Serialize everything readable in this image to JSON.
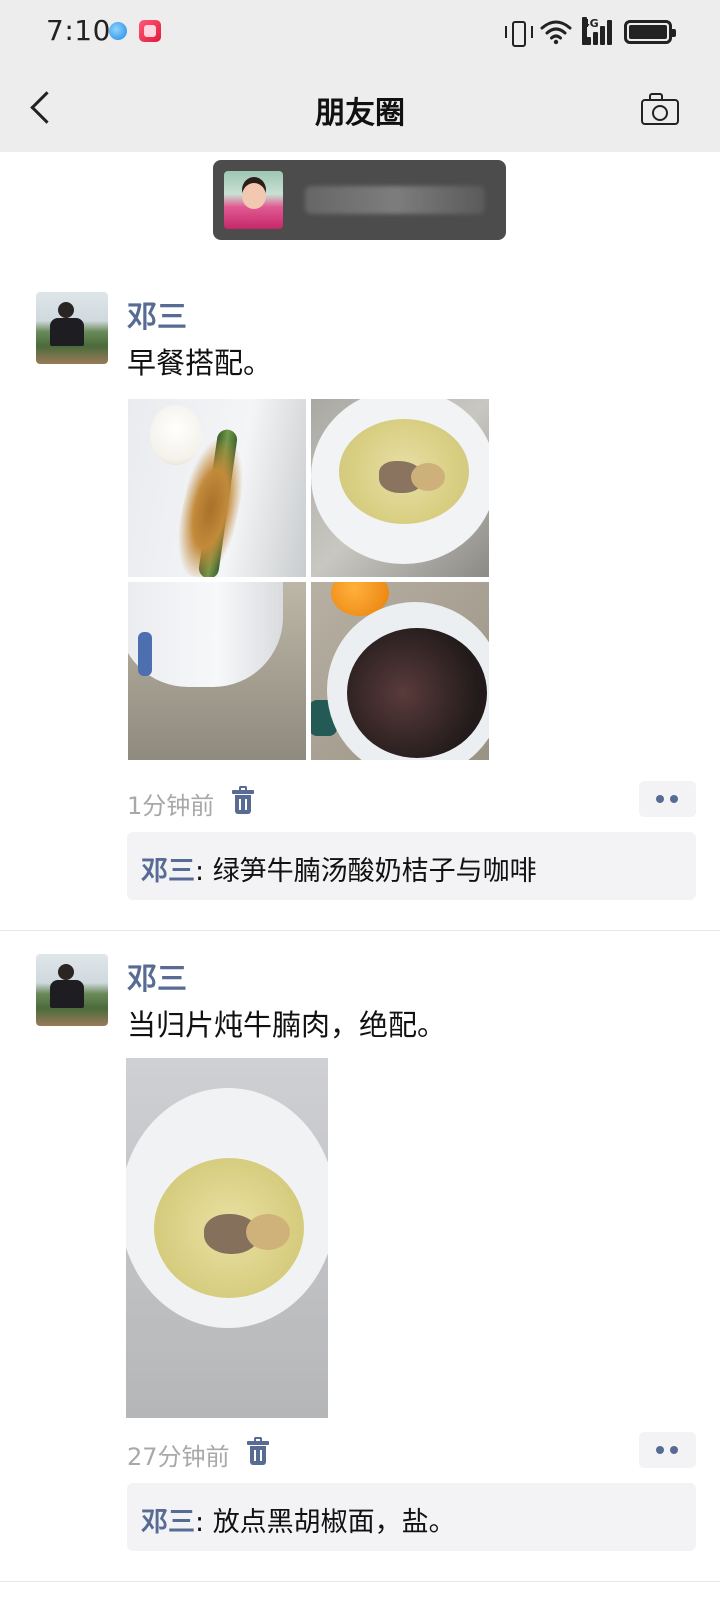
{
  "status_bar": {
    "time": "7:10",
    "network_label": "4G",
    "icons": [
      "browser-app-icon",
      "game-app-icon",
      "vibrate-icon",
      "wifi-icon",
      "signal-icon",
      "battery-icon"
    ]
  },
  "nav": {
    "title": "朋友圈",
    "back_icon": "chevron-left-icon",
    "camera_icon": "camera-icon"
  },
  "notification": {
    "avatar_icon": "avatar-image"
  },
  "posts": [
    {
      "author": "邓三",
      "text": "早餐搭配。",
      "photos": [
        "egg-bamboo-photo",
        "soup-bowl-photo",
        "yogurt-photo",
        "coffee-photo"
      ],
      "time": "1分钟前",
      "comment": {
        "author": "邓三",
        "separator": ": ",
        "text": "绿笋牛腩汤酸奶桔子与咖啡"
      }
    },
    {
      "author": "邓三",
      "text": "当归片炖牛腩肉，绝配。",
      "photos": [
        "beef-soup-photo"
      ],
      "time": "27分钟前",
      "comment": {
        "author": "邓三",
        "separator": ": ",
        "text": "放点黑胡椒面，盐。"
      }
    }
  ],
  "colors": {
    "link_blue": "#576b95",
    "header_bg": "#ededed",
    "comment_bg": "#f3f3f5",
    "time_gray": "#a8a8a8"
  }
}
